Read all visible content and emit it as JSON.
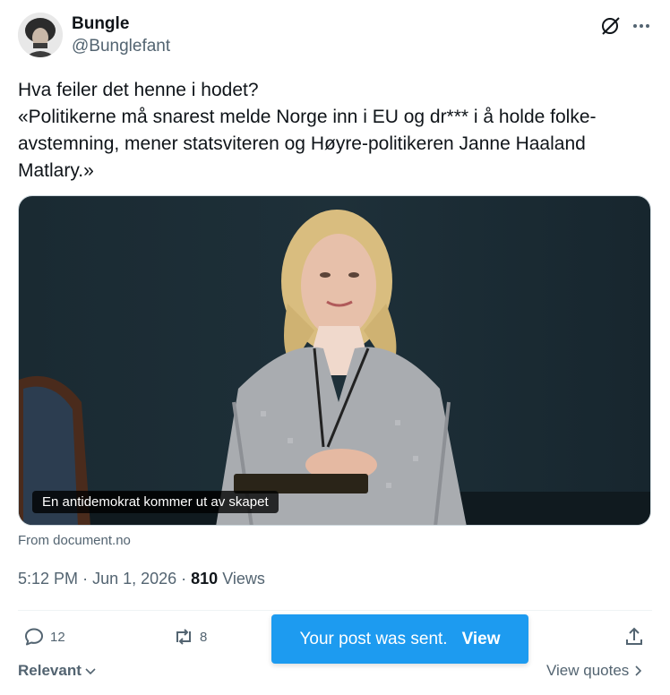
{
  "author": {
    "name": "Bungle",
    "handle": "@Bunglefant"
  },
  "post": {
    "lines": [
      "Hva feiler det henne i hodet?",
      "«Politikerne må snarest melde Norge inn i EU og dr*** i å holde folke-",
      "avstemning, mener statsviteren og Høyre-politikeren Janne Haaland",
      "Matlary.»"
    ]
  },
  "media": {
    "caption": "En antidemokrat kommer ut av skapet",
    "source": "From document.no"
  },
  "meta": {
    "time": "5:12 PM",
    "date": "Jun 1, 2026",
    "views_count": "810",
    "views_label": "Views"
  },
  "actions": {
    "replies": "12",
    "reposts": "8"
  },
  "toast": {
    "message": "Your post was sent.",
    "action": "View"
  },
  "footer": {
    "sort_label": "Relevant",
    "quotes_label": "View quotes"
  },
  "icons": {
    "grok": "grok-icon",
    "more": "more-icon",
    "reply": "reply-icon",
    "repost": "repost-icon",
    "share": "share-icon"
  },
  "colors": {
    "accent": "#1d9bf0",
    "secondary_text": "#536471",
    "primary_text": "#0f1419"
  }
}
